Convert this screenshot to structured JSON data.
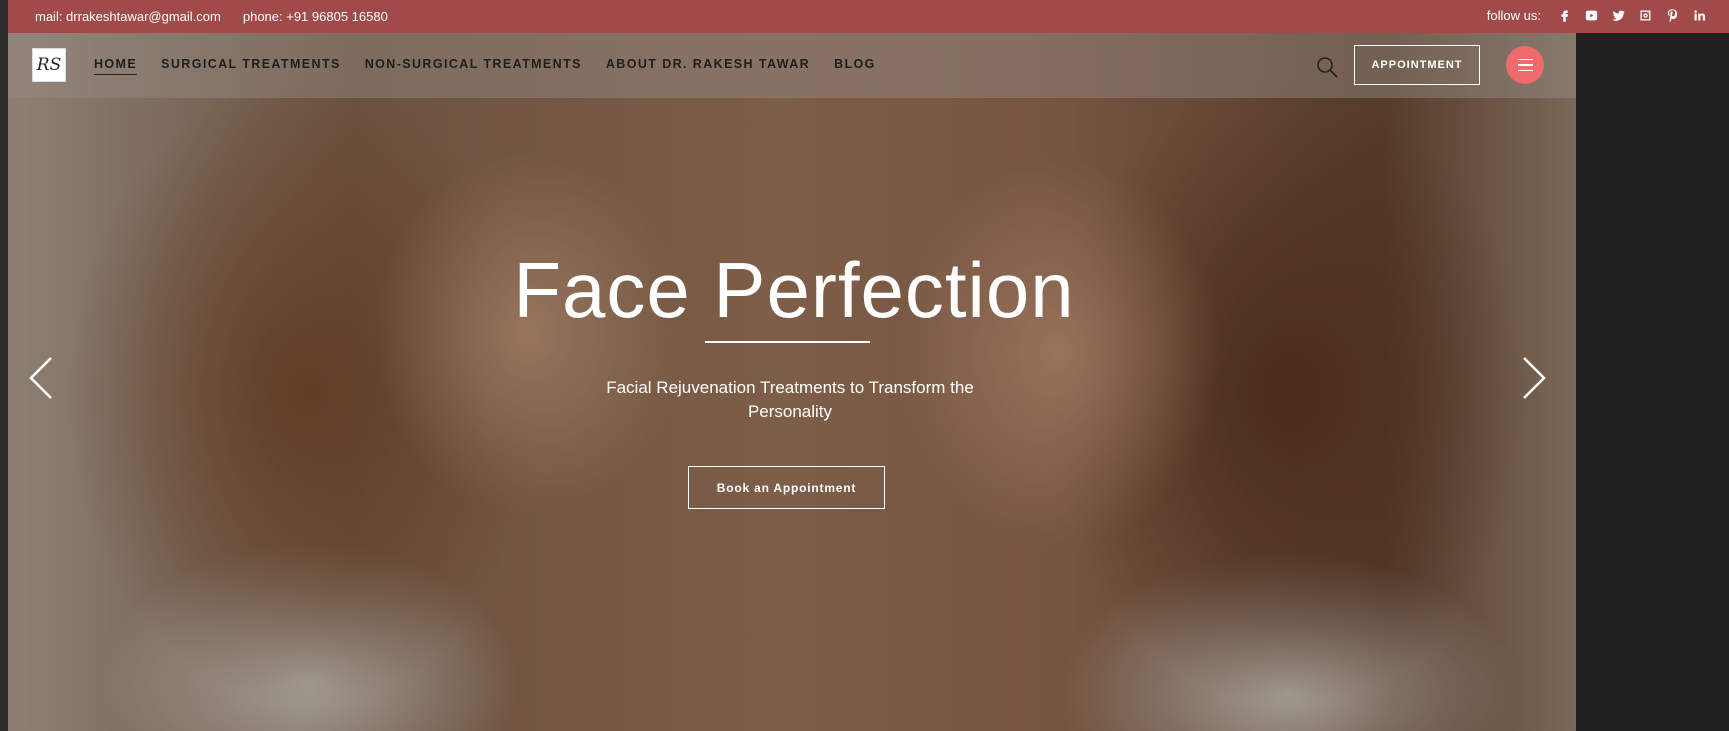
{
  "topbar": {
    "mail": "mail: drrakeshtawar@gmail.com",
    "phone": "phone: +91 96805 16580",
    "follow_label": "follow us:",
    "social_icons": [
      "facebook-icon",
      "youtube-icon",
      "twitter-icon",
      "instagram-icon",
      "pinterest-icon",
      "linkedin-icon"
    ]
  },
  "nav": {
    "logo_text": "RS",
    "items": [
      {
        "label": "HOME",
        "active": true
      },
      {
        "label": "SURGICAL TREATMENTS",
        "active": false
      },
      {
        "label": "NON-SURGICAL TREATMENTS",
        "active": false
      },
      {
        "label": "ABOUT DR. RAKESH TAWAR",
        "active": false
      },
      {
        "label": "BLOG",
        "active": false
      }
    ],
    "appointment_label": "APPOINTMENT"
  },
  "hero": {
    "title": "Face Perfection",
    "subtitle": "Facial Rejuvenation Treatments to Transform the Personality",
    "cta_label": "Book an Appointment"
  },
  "colors": {
    "topbar_bg": "#a14a49",
    "menu_button": "#f06b6d"
  }
}
